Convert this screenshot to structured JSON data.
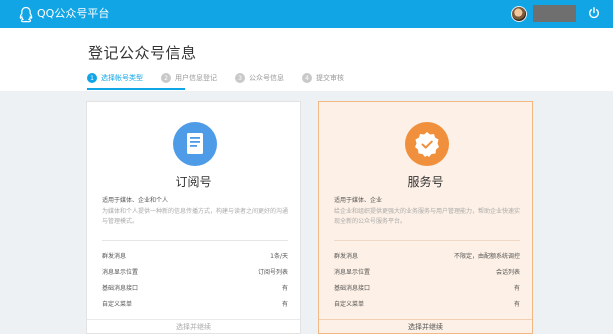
{
  "header": {
    "brand": "QQ公众号平台",
    "colors": {
      "bar": "#12a5e6"
    },
    "icons": [
      "qq-logo-icon",
      "avatar",
      "power-icon"
    ]
  },
  "page": {
    "title": "登记公众号信息"
  },
  "steps": [
    {
      "num": "1",
      "label": "选择帐号类型",
      "active": true
    },
    {
      "num": "2",
      "label": "用户信息登记",
      "active": false
    },
    {
      "num": "3",
      "label": "公众号信息",
      "active": false
    },
    {
      "num": "4",
      "label": "提交审核",
      "active": false
    }
  ],
  "cards": {
    "subscription": {
      "title": "订阅号",
      "suitable": "适用于媒体、企业和个人",
      "desc": "为媒体和个人提供一种新的信息传播方式，构建与读者之间更好的沟通与管理模式。",
      "features": [
        {
          "label": "群发消息",
          "value": "1条/天"
        },
        {
          "label": "消息显示位置",
          "value": "订阅号列表"
        },
        {
          "label": "基础消息接口",
          "value": "有"
        },
        {
          "label": "自定义菜单",
          "value": "有"
        }
      ],
      "action": "选择并继续",
      "color": "#4e9be8"
    },
    "service": {
      "title": "服务号",
      "suitable": "适用于媒体、企业",
      "desc": "给企业和组织提供更强大的业务服务与用户管理能力，帮助企业快速实现全新的公众号服务平台。",
      "features": [
        {
          "label": "群发消息",
          "value": "不限定，由配额系统调控"
        },
        {
          "label": "消息显示位置",
          "value": "会话列表"
        },
        {
          "label": "基础消息接口",
          "value": "有"
        },
        {
          "label": "自定义菜单",
          "value": "有"
        }
      ],
      "action": "选择并继续",
      "color": "#f08f3c"
    }
  }
}
